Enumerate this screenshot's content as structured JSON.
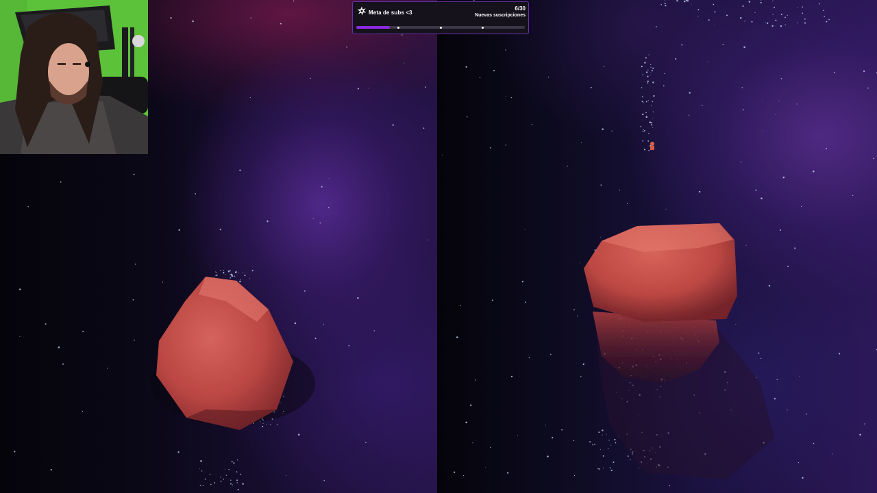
{
  "sub_goal": {
    "icon": "star-burst-icon",
    "title": "Meta de subs <3",
    "count": "6/30",
    "subtitle": "Nuevas suscripciones",
    "progress_fraction": 0.2,
    "milestone_fractions": [
      0.25,
      0.5,
      0.75
    ],
    "accent_color": "#8a2be2"
  },
  "webcam": {
    "background_color": "#5cc23a"
  },
  "game": {
    "split_screen_panes": 2,
    "scene_colors": {
      "deep": "#06040d",
      "purple": "#3a1f6e",
      "rock": "#c9534f"
    }
  }
}
